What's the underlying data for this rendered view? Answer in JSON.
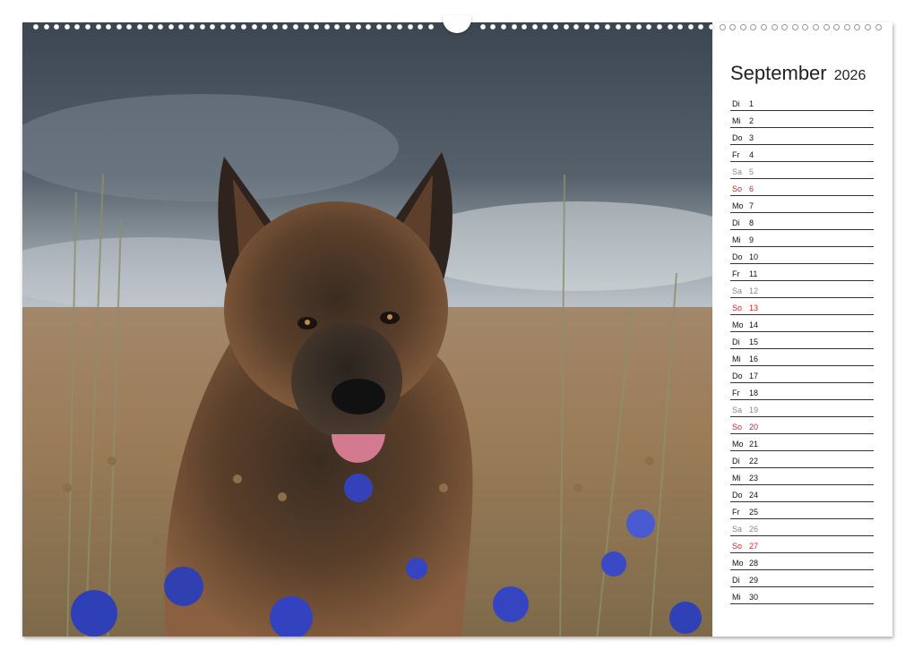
{
  "calendar": {
    "month": "September",
    "year": "2026",
    "days": [
      {
        "dn": "Di",
        "d": "1",
        "type": "weekday"
      },
      {
        "dn": "Mi",
        "d": "2",
        "type": "weekday"
      },
      {
        "dn": "Do",
        "d": "3",
        "type": "weekday"
      },
      {
        "dn": "Fr",
        "d": "4",
        "type": "weekday"
      },
      {
        "dn": "Sa",
        "d": "5",
        "type": "sat"
      },
      {
        "dn": "So",
        "d": "6",
        "type": "sun"
      },
      {
        "dn": "Mo",
        "d": "7",
        "type": "weekday"
      },
      {
        "dn": "Di",
        "d": "8",
        "type": "weekday"
      },
      {
        "dn": "Mi",
        "d": "9",
        "type": "weekday"
      },
      {
        "dn": "Do",
        "d": "10",
        "type": "weekday"
      },
      {
        "dn": "Fr",
        "d": "11",
        "type": "weekday"
      },
      {
        "dn": "Sa",
        "d": "12",
        "type": "sat"
      },
      {
        "dn": "So",
        "d": "13",
        "type": "sun"
      },
      {
        "dn": "Mo",
        "d": "14",
        "type": "weekday"
      },
      {
        "dn": "Di",
        "d": "15",
        "type": "weekday"
      },
      {
        "dn": "Mi",
        "d": "16",
        "type": "weekday"
      },
      {
        "dn": "Do",
        "d": "17",
        "type": "weekday"
      },
      {
        "dn": "Fr",
        "d": "18",
        "type": "weekday"
      },
      {
        "dn": "Sa",
        "d": "19",
        "type": "sat"
      },
      {
        "dn": "So",
        "d": "20",
        "type": "sun"
      },
      {
        "dn": "Mo",
        "d": "21",
        "type": "weekday"
      },
      {
        "dn": "Di",
        "d": "22",
        "type": "weekday"
      },
      {
        "dn": "Mi",
        "d": "23",
        "type": "weekday"
      },
      {
        "dn": "Do",
        "d": "24",
        "type": "weekday"
      },
      {
        "dn": "Fr",
        "d": "25",
        "type": "weekday"
      },
      {
        "dn": "Sa",
        "d": "26",
        "type": "sat"
      },
      {
        "dn": "So",
        "d": "27",
        "type": "sun"
      },
      {
        "dn": "Mo",
        "d": "28",
        "type": "weekday"
      },
      {
        "dn": "Di",
        "d": "29",
        "type": "weekday"
      },
      {
        "dn": "Mi",
        "d": "30",
        "type": "weekday"
      }
    ]
  },
  "colors": {
    "sunday": "#c4282a",
    "saturday": "#888888",
    "weekday": "#111111"
  },
  "photo": {
    "subject_icon": "german-shepherd-photo"
  }
}
